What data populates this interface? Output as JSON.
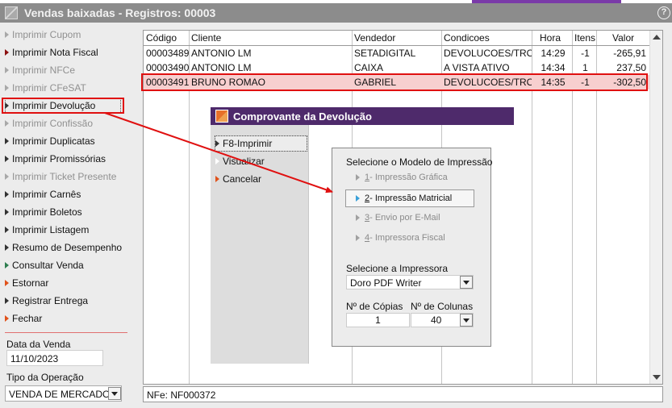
{
  "window": {
    "title": "Vendas baixadas - Registros: 00003"
  },
  "sidebar": {
    "items": [
      {
        "label": "Imprimir Cupom",
        "state": "disabled"
      },
      {
        "label": "Imprimir Nota Fiscal",
        "state": "red"
      },
      {
        "label": "Imprimir NFCe",
        "state": "disabled"
      },
      {
        "label": "Imprimir CFeSAT",
        "state": "disabled"
      },
      {
        "label": "Imprimir Devolução",
        "state": "focused"
      },
      {
        "label": "Imprimir Confissão",
        "state": "disabled"
      },
      {
        "label": "Imprimir Duplicatas",
        "state": "normal"
      },
      {
        "label": "Imprimir Promissórias",
        "state": "normal"
      },
      {
        "label": "Imprimir Ticket Presente",
        "state": "disabled"
      },
      {
        "label": "Imprimir Carnês",
        "state": "normal"
      },
      {
        "label": "Imprimir Boletos",
        "state": "normal"
      },
      {
        "label": "Imprimir Listagem",
        "state": "normal"
      },
      {
        "label": "Resumo de Desempenho",
        "state": "normal"
      },
      {
        "label": "Consultar Venda",
        "state": "green"
      },
      {
        "label": "Estornar",
        "state": "orange"
      },
      {
        "label": "Registrar Entrega",
        "state": "normal"
      },
      {
        "label": "Fechar",
        "state": "orange"
      }
    ],
    "date_label": "Data da Venda",
    "date_value": "11/10/2023",
    "operation_label": "Tipo da Operação",
    "operation_value": "VENDA DE MERCADOR"
  },
  "table": {
    "columns": [
      "Código",
      "Cliente",
      "Vendedor",
      "Condicoes",
      "Hora",
      "Itens",
      "Valor"
    ],
    "rows": [
      [
        "00003489",
        "ANTONIO LM",
        "SETADIGITAL",
        "DEVOLUCOES/TROC",
        "14:29",
        "-1",
        "-265,91"
      ],
      [
        "00003490",
        "ANTONIO LM",
        "CAIXA",
        "A VISTA ATIVO",
        "14:34",
        "1",
        "237,50"
      ],
      [
        "00003491",
        "BRUNO ROMAO",
        "GABRIEL",
        "DEVOLUCOES/TROC",
        "14:35",
        "-1",
        "-302,50"
      ]
    ],
    "selected_row": 2
  },
  "status": {
    "text": "NFe: NF000372"
  },
  "dialog": {
    "title": "Comprovante da Devolução",
    "buttons": [
      "F8-Imprimir",
      "Visualizar",
      "Cancelar"
    ],
    "model_label": "Selecione o Modelo de Impressão",
    "options": [
      {
        "key": "1",
        "label": " - Impressão Gráfica",
        "active": false
      },
      {
        "key": "2",
        "label": " - Impressão Matricial",
        "active": true
      },
      {
        "key": "3",
        "label": " - Envio por E-Mail",
        "active": false
      },
      {
        "key": "4",
        "label": " - Impressora Fiscal",
        "active": false
      }
    ],
    "printer_label": "Selecione a Impressora",
    "printer_value": "Doro PDF Writer",
    "copies_label": "Nº de Cópias",
    "copies_value": "1",
    "columns_label": "Nº de Colunas",
    "columns_value": "40"
  },
  "colors": {
    "title_bar": "#8c8c8c",
    "dialog_title": "#4e2a6b",
    "highlight": "#e01010",
    "selected_row": "#f7cfcf"
  }
}
